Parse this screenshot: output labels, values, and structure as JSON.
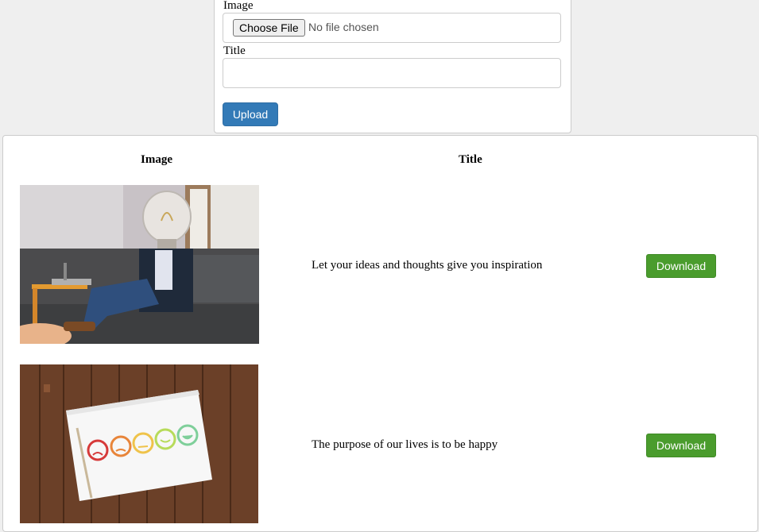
{
  "upload_form": {
    "image_label": "Image",
    "choose_file_label": "Choose File",
    "file_status": "No file chosen",
    "title_label": "Title",
    "title_value": "",
    "upload_label": "Upload"
  },
  "table": {
    "headers": [
      "Image",
      "Title"
    ],
    "rows": [
      {
        "image": "lightbulb-head-man-on-sofa",
        "title": "Let your ideas and thoughts give you inspiration",
        "action": "Download"
      },
      {
        "image": "smiley-rating-card-on-wood",
        "title": "The purpose of our lives is to be happy",
        "action": "Download"
      }
    ]
  },
  "colors": {
    "upload_button": "#337ab7",
    "download_button": "#4a9c2d",
    "background": "#efefef"
  }
}
